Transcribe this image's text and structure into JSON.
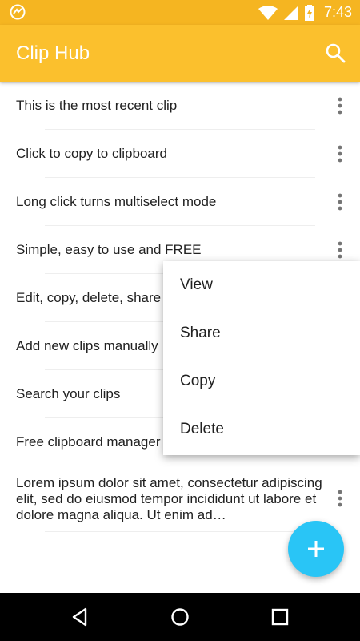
{
  "status_bar": {
    "time": "7:43",
    "icons": [
      "app-notification-icon",
      "wifi-icon",
      "cell-signal-icon",
      "battery-charging-icon"
    ]
  },
  "app_bar": {
    "title": "Clip Hub",
    "search_icon": "search-icon"
  },
  "clips": [
    {
      "text": "This is the most recent clip"
    },
    {
      "text": "Click to copy to clipboard"
    },
    {
      "text": "Long click turns multiselect mode"
    },
    {
      "text": "Simple, easy to use and FREE"
    },
    {
      "text": "Edit, copy, delete, share y"
    },
    {
      "text": "Add new clips manually"
    },
    {
      "text": "Search your clips"
    },
    {
      "text": "Free clipboard manager"
    },
    {
      "text": "Lorem ipsum dolor sit amet, consectetur adipiscing elit, sed do eiusmod tempor incididunt ut labore et dolore magna aliqua. Ut enim ad…"
    }
  ],
  "context_menu": {
    "items": [
      "View",
      "Share",
      "Copy",
      "Delete"
    ]
  },
  "fab": {
    "icon": "plus-icon"
  },
  "nav_bar": {
    "icons": [
      "back-icon",
      "home-icon",
      "recents-icon"
    ]
  },
  "colors": {
    "status_bar": "#f5b521",
    "app_bar": "#fbc02d",
    "fab": "#29c5f6",
    "text": "#212121"
  }
}
